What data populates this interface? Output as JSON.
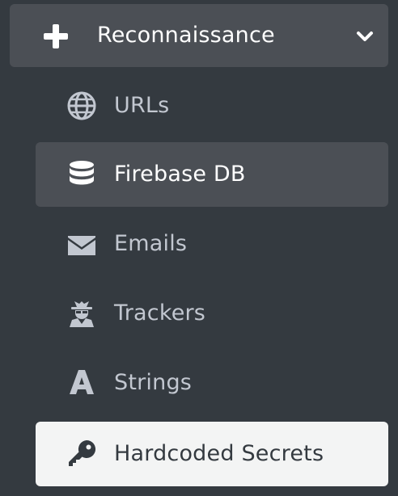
{
  "sidebar": {
    "section": {
      "label": "Reconnaissance",
      "icon": "plus-icon",
      "expand_icon": "chevron-down-icon"
    },
    "items": [
      {
        "label": "URLs",
        "icon": "globe-icon",
        "state": "default"
      },
      {
        "label": "Firebase DB",
        "icon": "database-icon",
        "state": "hover"
      },
      {
        "label": "Emails",
        "icon": "envelope-icon",
        "state": "default"
      },
      {
        "label": "Trackers",
        "icon": "user-secret-icon",
        "state": "default"
      },
      {
        "label": "Strings",
        "icon": "font-icon",
        "state": "default"
      },
      {
        "label": "Hardcoded Secrets",
        "icon": "key-icon",
        "state": "active"
      }
    ]
  },
  "colors": {
    "background": "#343a40",
    "item_text": "#c2c7d0",
    "hover_bg": "#4b4f55",
    "active_bg": "#f3f4f4",
    "active_text": "#343a40"
  }
}
